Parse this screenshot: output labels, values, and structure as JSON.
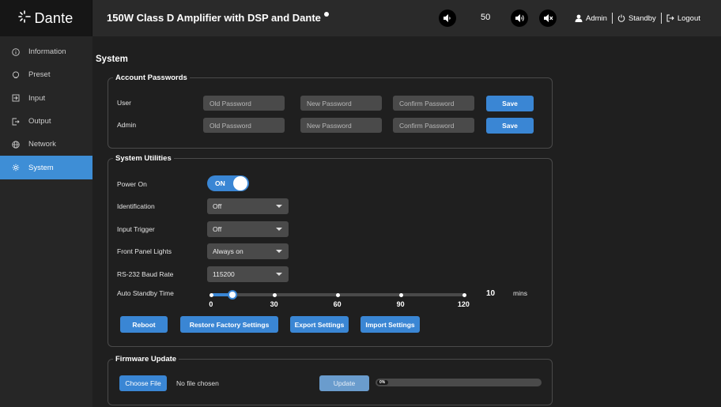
{
  "brand": {
    "logo_text": "Dante"
  },
  "header": {
    "title": "150W Class D Amplifier with DSP and Dante",
    "volume_value": "50",
    "admin_label": "Admin",
    "standby_label": "Standby",
    "logout_label": "Logout"
  },
  "sidebar": {
    "items": [
      {
        "label": "Information",
        "icon": "info-icon",
        "active": false
      },
      {
        "label": "Preset",
        "icon": "preset-icon",
        "active": false
      },
      {
        "label": "Input",
        "icon": "input-icon",
        "active": false
      },
      {
        "label": "Output",
        "icon": "output-icon",
        "active": false
      },
      {
        "label": "Network",
        "icon": "network-icon",
        "active": false
      },
      {
        "label": "System",
        "icon": "gear-icon",
        "active": true
      }
    ]
  },
  "main": {
    "title": "System",
    "account": {
      "legend": "Account Passwords",
      "rows": [
        {
          "label": "User",
          "old_placeholder": "Old Password",
          "new_placeholder": "New Password",
          "confirm_placeholder": "Confirm Password",
          "save_label": "Save"
        },
        {
          "label": "Admin",
          "old_placeholder": "Old Password",
          "new_placeholder": "New Password",
          "confirm_placeholder": "Confirm Password",
          "save_label": "Save"
        }
      ]
    },
    "utilities": {
      "legend": "System Utilities",
      "power_on_label": "Power On",
      "power_on_value": "ON",
      "identification_label": "Identification",
      "identification_value": "Off",
      "input_trigger_label": "Input Trigger",
      "input_trigger_value": "Off",
      "front_panel_label": "Front Panel Lights",
      "front_panel_value": "Always on",
      "baud_label": "RS-232 Baud Rate",
      "baud_value": "115200",
      "standby_time_label": "Auto Standby Time",
      "standby_ticks": [
        "0",
        "30",
        "60",
        "90",
        "120"
      ],
      "standby_value": "10",
      "standby_unit": "mins",
      "standby_max": 120,
      "reboot_label": "Reboot",
      "restore_label": "Restore Factory Settings",
      "export_label": "Export Settings",
      "import_label": "Import Settings"
    },
    "firmware": {
      "legend": "Firmware Update",
      "choose_label": "Choose File",
      "file_status": "No file chosen",
      "update_label": "Update",
      "progress_text": "0%",
      "progress_value": 0
    }
  },
  "colors": {
    "accent": "#3a86d4",
    "sidebar_active": "#3e8ed6",
    "background": "#1f1f1f"
  }
}
